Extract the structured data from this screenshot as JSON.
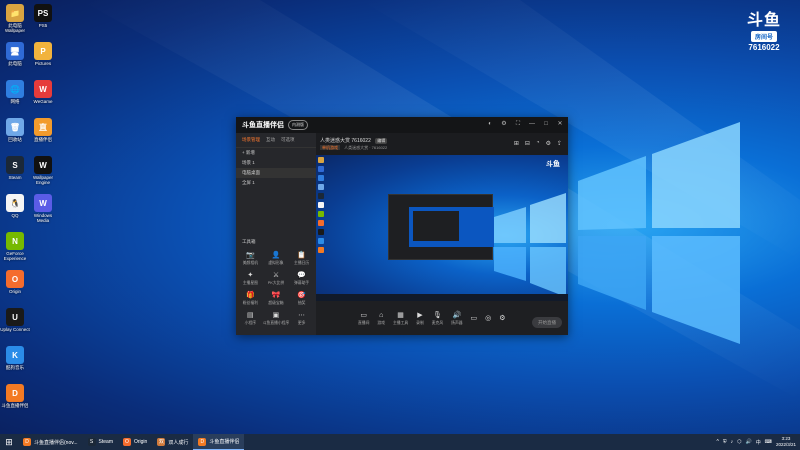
{
  "desktop": {
    "icons": [
      {
        "label": "此电脑 Wallpaper",
        "bg": "#d9a441",
        "glyph": "📁"
      },
      {
        "label": "此电脑",
        "bg": "#2f6ad6",
        "glyph": "🖥"
      },
      {
        "label": "网络",
        "bg": "#2f7ee0",
        "glyph": "🌐"
      },
      {
        "label": "回收站",
        "bg": "#6fa8e8",
        "glyph": "🗑"
      },
      {
        "label": "Steam",
        "bg": "#1b2838",
        "glyph": "S"
      },
      {
        "label": "QQ",
        "bg": "#f5f5f5",
        "glyph": "🐧"
      },
      {
        "label": "GeForce Experience",
        "bg": "#76b900",
        "glyph": "N"
      },
      {
        "label": "Origin",
        "bg": "#f56c2d",
        "glyph": "O"
      },
      {
        "label": "Uplay Connect",
        "bg": "#1a1a1a",
        "glyph": "U"
      },
      {
        "label": "酷狗音乐",
        "bg": "#2b8ce8",
        "glyph": "K"
      },
      {
        "label": "斗鱼直播伴侣",
        "bg": "#f37a23",
        "glyph": "D"
      },
      {
        "label": "PS5",
        "bg": "#111",
        "glyph": "PS"
      },
      {
        "label": "Pictures",
        "bg": "#f2b33d",
        "glyph": "P"
      },
      {
        "label": "WeGame",
        "bg": "#e63b3b",
        "glyph": "W"
      },
      {
        "label": "直播伴侣",
        "bg": "#f29b2c",
        "glyph": "直"
      },
      {
        "label": "Wallpaper Engine",
        "bg": "#111",
        "glyph": "W"
      },
      {
        "label": "Windows Media",
        "bg": "#5b5ce6",
        "glyph": "W"
      }
    ]
  },
  "douyu_logo": {
    "mark": "斗鱼",
    "room_label": "房间号",
    "room_number": "7616022"
  },
  "app": {
    "title": "斗鱼直播伴侣",
    "version_badge": "内测版",
    "window_buttons": [
      "◐",
      "⚙",
      "⛶",
      "—",
      "□",
      "✕"
    ],
    "sidebar": {
      "tabs": [
        "场景管理",
        "互动",
        "可选项"
      ],
      "scenes": [
        "+ 新增",
        "场景 1",
        "电脑桌面",
        "全屏 1"
      ],
      "tools_title": "工具箱",
      "tools": [
        {
          "label": "美颜相机",
          "glyph": "📷",
          "hot": true
        },
        {
          "label": "虚拟形象",
          "glyph": "👤",
          "hot": false
        },
        {
          "label": "主播日历",
          "glyph": "📋",
          "hot": false
        },
        {
          "label": "主播星图",
          "glyph": "✦",
          "hot": false
        },
        {
          "label": "PK大比拼",
          "glyph": "⚔",
          "hot": false
        },
        {
          "label": "弹幕助手",
          "glyph": "💬",
          "hot": false
        },
        {
          "label": "粉丝福利",
          "glyph": "🎁",
          "hot": true
        },
        {
          "label": "超级宝箱",
          "glyph": "🎀",
          "hot": false
        },
        {
          "label": "抽奖",
          "glyph": "🎯",
          "hot": true
        },
        {
          "label": "小程序",
          "glyph": "▤",
          "hot": false
        },
        {
          "label": "斗鱼直播小程序",
          "glyph": "▣",
          "hot": false
        },
        {
          "label": "更多",
          "glyph": "⋯",
          "hot": false
        }
      ]
    },
    "room": {
      "title": "人类迷惑大赏 7616022",
      "tag": "编辑",
      "category": "单机游戏",
      "sub": "人类迷惑大赏 · 7616022"
    },
    "room_icons": [
      "⊞",
      "⊟",
      "◔",
      "⚙",
      "⇪"
    ],
    "preview_logo": "斗鱼",
    "controls": [
      {
        "label": "直播间",
        "glyph": "▭"
      },
      {
        "label": "游戏",
        "glyph": "⌂"
      },
      {
        "label": "主播工具",
        "glyph": "▦"
      },
      {
        "label": "录制",
        "glyph": "▶"
      },
      {
        "label": "麦克风",
        "glyph": "🎙"
      },
      {
        "label": "扬声器",
        "glyph": "🔊"
      },
      {
        "label": "",
        "glyph": "▭"
      },
      {
        "label": "",
        "glyph": "◎"
      },
      {
        "label": "",
        "glyph": "⚙"
      }
    ],
    "start_live": "开始直播"
  },
  "taskbar": {
    "start_glyph": "⊞",
    "items": [
      {
        "label": "斗鱼直播伴侣(nov...",
        "glyph": "D",
        "bg": "#f37a23",
        "active": false
      },
      {
        "label": "Steam",
        "glyph": "S",
        "bg": "#1b2838",
        "active": false
      },
      {
        "label": "Origin",
        "glyph": "O",
        "bg": "#f56c2d",
        "active": false
      },
      {
        "label": "双人成行",
        "glyph": "双",
        "bg": "#d07a3b",
        "active": false
      },
      {
        "label": "斗鱼直播伴侣",
        "glyph": "D",
        "bg": "#f37a23",
        "active": true
      }
    ],
    "tray_icons": [
      "^",
      "⛨",
      "♪",
      "⬡",
      "🔊",
      "中",
      "⌨"
    ],
    "time": "3:23",
    "date": "2022/3/21"
  }
}
